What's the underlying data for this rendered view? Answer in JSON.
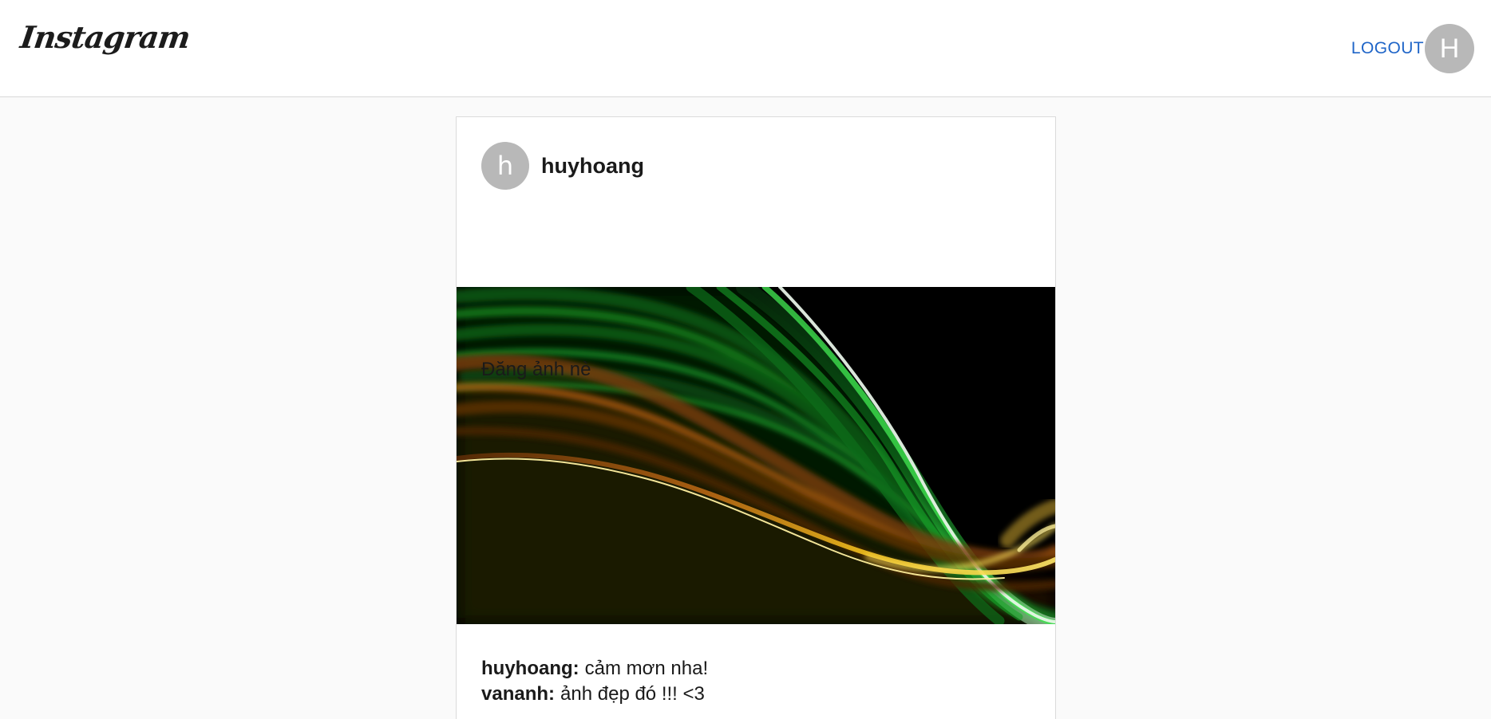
{
  "header": {
    "logo_text": "Instagram",
    "logout_label": "LOGOUT",
    "user_avatar_initial": "H"
  },
  "post": {
    "author": {
      "avatar_initial": "h",
      "username": "huyhoang"
    },
    "caption": "Đăng ảnh nè",
    "image": {
      "description": "green and orange light waves on black background"
    },
    "comments": [
      {
        "username": "huyhoang",
        "separator": ":",
        "text": "cảm mơn nha!"
      },
      {
        "username": "vananh",
        "separator": ":",
        "text": "ảnh đẹp đó !!! <3"
      }
    ]
  },
  "colors": {
    "page_background": "#fafafa",
    "card_background": "#ffffff",
    "header_border": "#d8d8d8",
    "card_border": "#dbdbdb",
    "link_blue": "#1f65c8",
    "avatar_gray": "#b8b8b8",
    "text_dark": "#1a1a1a",
    "image_background": "#000000"
  }
}
